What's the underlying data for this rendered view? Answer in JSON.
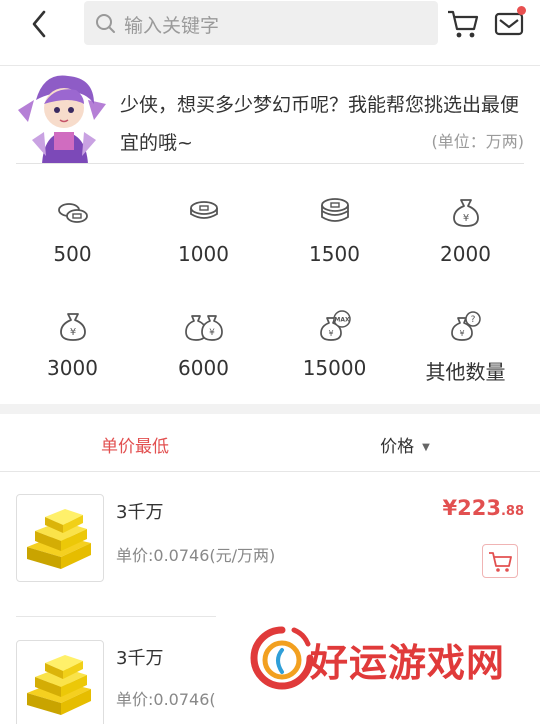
{
  "search": {
    "placeholder": "输入关键字"
  },
  "intro": {
    "text": "少侠，想买多少梦幻币呢？我能帮您挑选出最便宜的哦~",
    "unit": "(单位：万两)"
  },
  "amounts": [
    {
      "label": "500",
      "icon": "coin-stack-small-icon"
    },
    {
      "label": "1000",
      "icon": "coin-stack-icon"
    },
    {
      "label": "1500",
      "icon": "coin-stack-large-icon"
    },
    {
      "label": "2000",
      "icon": "money-bag-icon"
    },
    {
      "label": "3000",
      "icon": "money-bag-icon"
    },
    {
      "label": "6000",
      "icon": "money-bags-icon"
    },
    {
      "label": "15000",
      "icon": "money-bag-max-icon"
    },
    {
      "label": "其他数量",
      "icon": "money-bag-question-icon"
    }
  ],
  "sort": {
    "lowest_unit_price": "单价最低",
    "price": "价格",
    "caret": "▼"
  },
  "items": [
    {
      "name": "3千万",
      "unit_price": "单价:0.0746(元/万两)",
      "price_main": "¥223",
      "price_decimal": ".88"
    },
    {
      "name": "3千万",
      "unit_price": "单价:0.0746("
    }
  ],
  "watermark": {
    "text": "好运游戏网"
  },
  "colors": {
    "accent": "#e25050",
    "background": "#ffffff",
    "separator": "#f2f2f2"
  }
}
